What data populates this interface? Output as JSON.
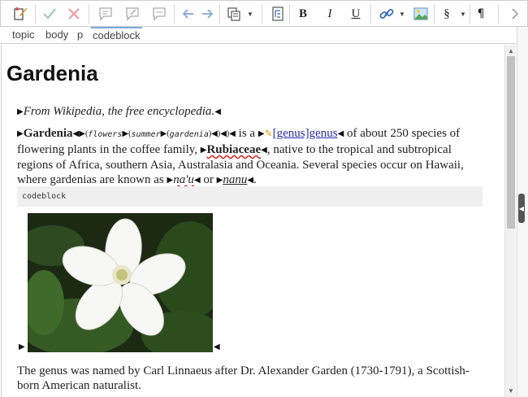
{
  "toolbar": {
    "bold": "B",
    "italic": "I",
    "underline": "U",
    "section": "§",
    "pilcrow": "¶"
  },
  "breadcrumb": [
    "topic",
    "body",
    "p",
    "codeblock"
  ],
  "doc": {
    "title": "Gardenia",
    "intro": "From Wikipedia, the free encyclopedia.",
    "p1": {
      "term": "Gardenia",
      "flowers": "flowers",
      "summer": "summer",
      "gardenia": "gardenia",
      "is_a": " is a ",
      "link": "[genus]genus",
      "t1": " of about 250 species of flowering plants in the coffee family, ",
      "rubiaceae": "Rubiaceae",
      "t2": ", native to the tropical and subtropical regions of Africa, southern Asia, Australasia and Oceania. Several species occur on Hawaii, where gardenias are known as ",
      "naiu": "na'u",
      "or": " or ",
      "nanu": "nanu",
      "end": "."
    },
    "codeblock": "codeblock",
    "p2": "The genus was named by Carl Linnaeus after Dr. Alexander Garden (1730-1791), a Scottish-born American naturalist."
  },
  "colors": {
    "accent": "#7aaae0",
    "link": "#2a2aa8"
  }
}
